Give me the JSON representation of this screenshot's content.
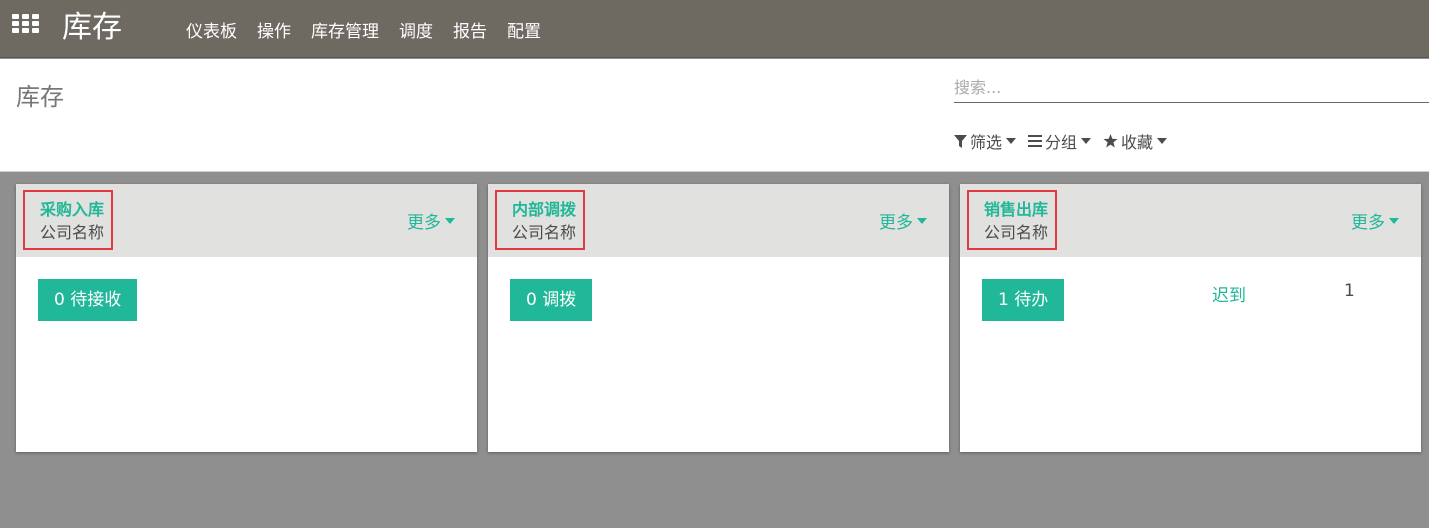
{
  "topbar": {
    "brand": "库存",
    "menu": [
      "仪表板",
      "操作",
      "库存管理",
      "调度",
      "报告",
      "配置"
    ]
  },
  "control_panel": {
    "breadcrumb": "库存",
    "search_placeholder": "搜索...",
    "filters_label": "筛选",
    "groupby_label": "分组",
    "favorites_label": "收藏"
  },
  "cards": [
    {
      "title": "采购入库",
      "company": "公司名称",
      "more_label": "更多",
      "action_label": "0 待接收"
    },
    {
      "title": "内部调拨",
      "company": "公司名称",
      "more_label": "更多",
      "action_label": "0 调拨"
    },
    {
      "title": "销售出库",
      "company": "公司名称",
      "more_label": "更多",
      "action_label": "1 待办",
      "late_label": "迟到",
      "late_count": "1"
    }
  ],
  "colors": {
    "topbar": "#6e6961",
    "accent": "#21b799",
    "highlight_border": "#e0393e",
    "card_header": "#e1e1df",
    "background": "#8f8f8f"
  },
  "icons": [
    "apps-grid-icon",
    "filter-icon",
    "list-icon",
    "star-icon",
    "caret-down-icon"
  ]
}
